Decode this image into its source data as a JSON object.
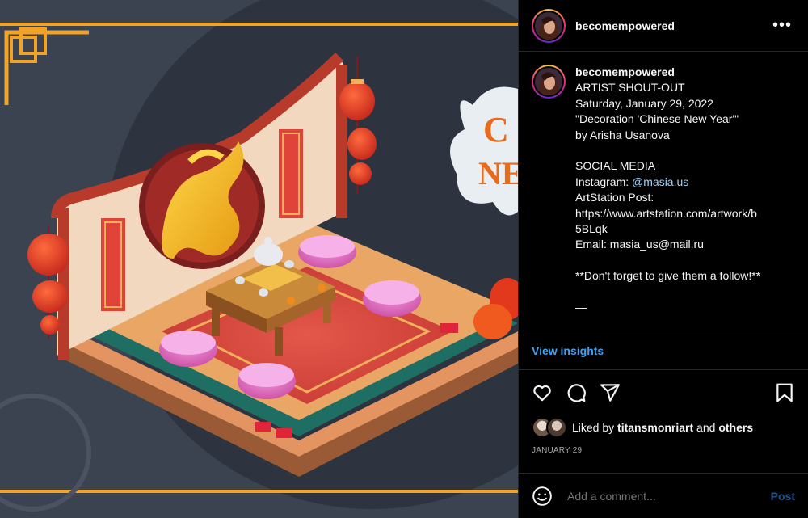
{
  "post": {
    "username": "becomempowered",
    "more_icon": "more-horizontal-icon"
  },
  "caption": {
    "username": "becomempowered",
    "lines": [
      "ARTIST SHOUT-OUT",
      "Saturday, January 29, 2022",
      "\"Decoration 'Chinese New Year'\"",
      "by Arisha Usanova",
      "",
      "SOCIAL MEDIA",
      "Instagram: ",
      "ArtStation Post:",
      "https://www.artstation.com/artwork/b",
      "5BLqk",
      "Email: masia_us@mail.ru",
      "",
      "**Don't forget to give them a follow!**",
      "",
      "—"
    ],
    "instagram_handle": "@masia.us"
  },
  "insights": {
    "label": "View insights"
  },
  "actions": {
    "like_icon": "heart-icon",
    "comment_icon": "comment-icon",
    "share_icon": "share-icon",
    "save_icon": "bookmark-icon"
  },
  "likes": {
    "prefix": "Liked by ",
    "user": "titansmonriart",
    "middle": " and ",
    "others": "others"
  },
  "date": "JANUARY 29",
  "comment_box": {
    "placeholder": "Add a comment...",
    "post_label": "Post"
  },
  "artwork": {
    "banner_text_1": "C",
    "banner_text_2": "NE"
  },
  "colors": {
    "link": "#3ea0f2",
    "muted": "#a8a8a8",
    "divider": "#262626",
    "art_bg": "#3b4250"
  }
}
